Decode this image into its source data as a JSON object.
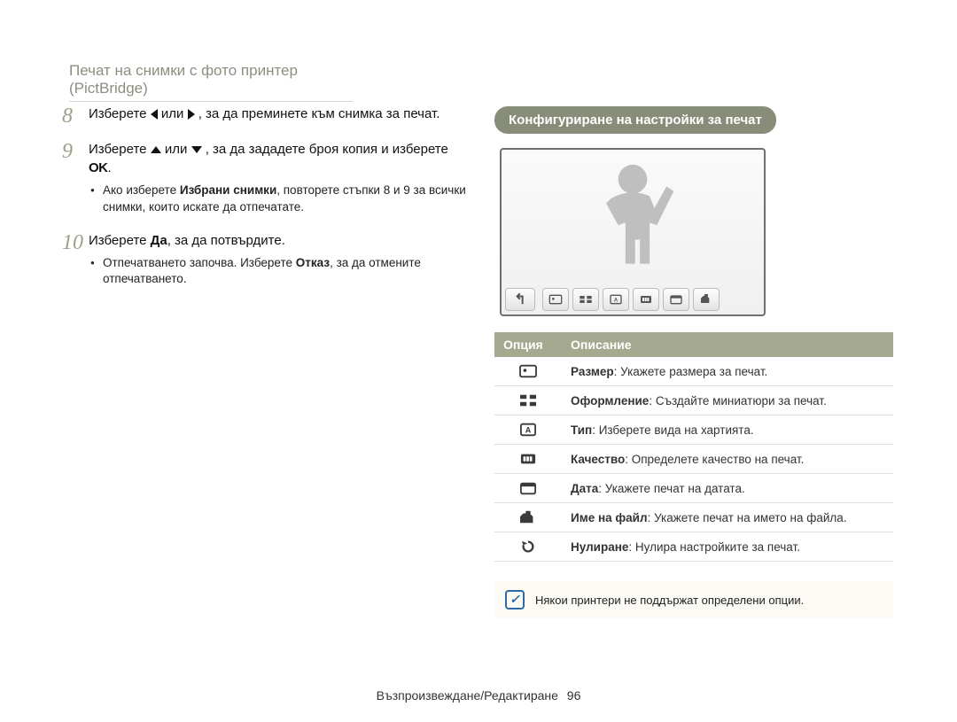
{
  "page_title": "Печат на снимки с фото принтер (PictBridge)",
  "steps": {
    "s8": {
      "num": "8",
      "pre": "Изберете ",
      "mid": " или ",
      "post": ", за да преминете към снимка за печат."
    },
    "s9": {
      "num": "9",
      "pre": "Изберете ",
      "mid": " или ",
      "post1": ", за да зададете броя копия и изберете ",
      "ok": "OK",
      "dot": ".",
      "bullet_pre": "Ако изберете ",
      "bullet_bold": "Избрани снимки",
      "bullet_post": ", повторете стъпки 8 и 9 за всички снимки, които искате да отпечатате."
    },
    "s10": {
      "num": "10",
      "pre": "Изберете ",
      "bold": "Да",
      "post": ", за да потвърдите.",
      "bullet_pre": "Отпечатването започва. Изберете ",
      "bullet_bold": "Отказ",
      "bullet_post": ", за да отмените отпечатването."
    }
  },
  "config_title": "Конфигуриране на настройки за печат",
  "table": {
    "head_option": "Опция",
    "head_desc": "Описание",
    "rows": [
      {
        "icon": "size",
        "label": "Размер",
        "desc": ": Укажете размера за печат."
      },
      {
        "icon": "layout",
        "label": "Оформление",
        "desc": ": Създайте миниатюри за печат."
      },
      {
        "icon": "type",
        "label": "Тип",
        "desc": ": Изберете вида на хартията."
      },
      {
        "icon": "quality",
        "label": "Качество",
        "desc": ": Определете качество на печат."
      },
      {
        "icon": "date",
        "label": "Дата",
        "desc": ": Укажете печат на датата."
      },
      {
        "icon": "filename",
        "label": "Име на файл",
        "desc": ": Укажете печат на името на файла."
      },
      {
        "icon": "reset",
        "label": "Нулиране",
        "desc": ": Нулира настройките за печат."
      }
    ]
  },
  "note": "Някои принтери не поддържат определени опции.",
  "footer_section": "Възпроизвеждане/Редактиране",
  "footer_page": "96"
}
